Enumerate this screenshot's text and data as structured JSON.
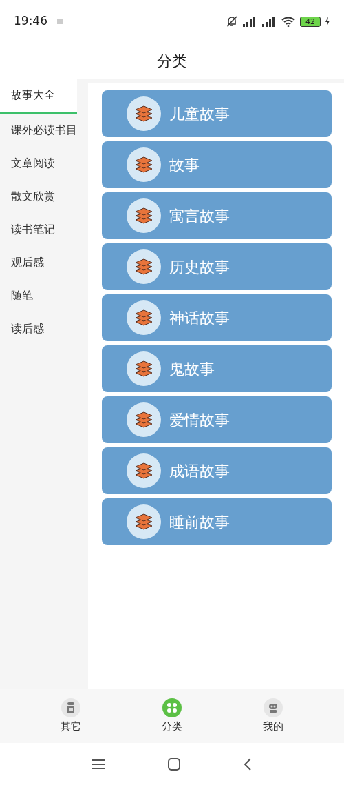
{
  "status_bar": {
    "time": "19:46",
    "battery": "42"
  },
  "title": "分类",
  "sidebar": {
    "items": [
      {
        "label": "故事大全",
        "selected": true
      },
      {
        "label": "课外必读书目",
        "selected": false
      },
      {
        "label": "文章阅读",
        "selected": false
      },
      {
        "label": "散文欣赏",
        "selected": false
      },
      {
        "label": "读书笔记",
        "selected": false
      },
      {
        "label": "观后感",
        "selected": false
      },
      {
        "label": "随笔",
        "selected": false
      },
      {
        "label": "读后感",
        "selected": false
      }
    ]
  },
  "categories": [
    "儿童故事",
    "故事",
    "寓言故事",
    "历史故事",
    "神话故事",
    "鬼故事",
    "爱情故事",
    "成语故事",
    "睡前故事"
  ],
  "bottom_nav": [
    {
      "label": "其它",
      "selected": false,
      "kind": "book"
    },
    {
      "label": "分类",
      "selected": true,
      "kind": "grid"
    },
    {
      "label": "我的",
      "selected": false,
      "kind": "robot"
    }
  ]
}
